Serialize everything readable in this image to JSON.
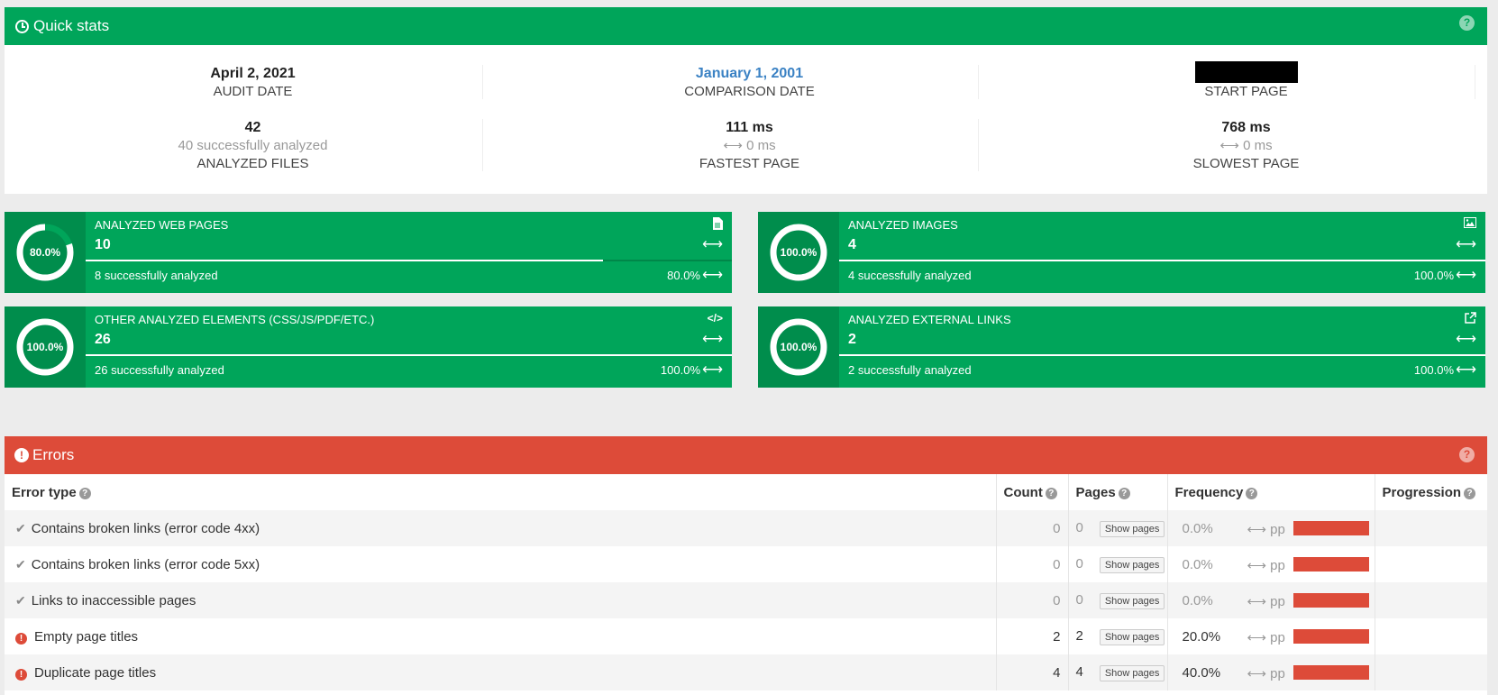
{
  "quick_stats": {
    "title": "Quick stats",
    "help": "?",
    "audit_date": {
      "value": "April 2, 2021",
      "label": "AUDIT DATE"
    },
    "comparison_date": {
      "value": "January 1, 2001",
      "label": "COMPARISON DATE"
    },
    "start_page": {
      "label": "START PAGE"
    },
    "analyzed_files": {
      "value": "42",
      "sub": "40 successfully analyzed",
      "label": "ANALYZED FILES"
    },
    "fastest_page": {
      "value": "111 ms",
      "sub": "⟷ 0 ms",
      "label": "FASTEST PAGE"
    },
    "slowest_page": {
      "value": "768 ms",
      "sub": "⟷ 0 ms",
      "label": "SLOWEST PAGE"
    }
  },
  "boxes": [
    {
      "title": "ANALYZED WEB PAGES",
      "count": "10",
      "ring_label": "80.0%",
      "fraction": 0.8,
      "footer": "8 successfully analyzed",
      "pct": "80.0%",
      "icon": "file-icon",
      "arrow": "⟷"
    },
    {
      "title": "ANALYZED IMAGES",
      "count": "4",
      "ring_label": "100.0%",
      "fraction": 1.0,
      "footer": "4 successfully analyzed",
      "pct": "100.0%",
      "icon": "image-icon",
      "arrow": "⟷"
    },
    {
      "title": "OTHER ANALYZED ELEMENTS (CSS/JS/PDF/ETC.)",
      "count": "26",
      "ring_label": "100.0%",
      "fraction": 1.0,
      "footer": "26 successfully analyzed",
      "pct": "100.0%",
      "icon": "code-icon",
      "arrow": "⟷"
    },
    {
      "title": "ANALYZED EXTERNAL LINKS",
      "count": "2",
      "ring_label": "100.0%",
      "fraction": 1.0,
      "footer": "2 successfully analyzed",
      "pct": "100.0%",
      "icon": "external-link-icon",
      "arrow": "⟷"
    }
  ],
  "errors": {
    "title": "Errors",
    "help": "?",
    "columns": [
      "Error type",
      "Count",
      "Pages",
      "Frequency",
      "Progression"
    ],
    "show_pages_label": "Show pages",
    "pp_label": "⟷ pp",
    "rows": [
      {
        "status": "ok",
        "type": "Contains broken links (error code 4xx)",
        "count": "0",
        "pages": "0",
        "frequency": "0.0%"
      },
      {
        "status": "ok",
        "type": "Contains broken links (error code 5xx)",
        "count": "0",
        "pages": "0",
        "frequency": "0.0%"
      },
      {
        "status": "ok",
        "type": "Links to inaccessible pages",
        "count": "0",
        "pages": "0",
        "frequency": "0.0%"
      },
      {
        "status": "error",
        "type": "Empty page titles",
        "count": "2",
        "pages": "2",
        "frequency": "20.0%"
      },
      {
        "status": "error",
        "type": "Duplicate page titles",
        "count": "4",
        "pages": "4",
        "frequency": "40.0%"
      }
    ]
  },
  "colors": {
    "green": "#00a55a",
    "dark_green": "#008d4c",
    "red": "#dd4b39",
    "blue_link": "#3b82c4"
  }
}
